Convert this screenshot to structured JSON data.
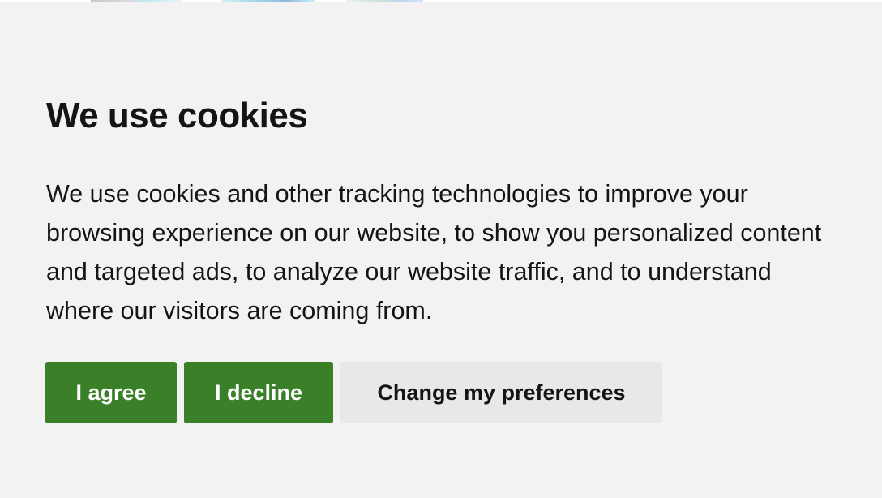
{
  "banner": {
    "title": "We use cookies",
    "description": "We use cookies and other tracking technologies to improve your browsing experience on our website, to show you personalized content and targeted ads, to analyze our website traffic, and to understand where our visitors are coming from.",
    "buttons": {
      "agree_label": "I agree",
      "decline_label": "I decline",
      "preferences_label": "Change my preferences"
    }
  },
  "colors": {
    "background": "#f2f2f2",
    "primary_button": "#3a8028",
    "secondary_button": "#e8e8e8",
    "text": "#141414"
  }
}
